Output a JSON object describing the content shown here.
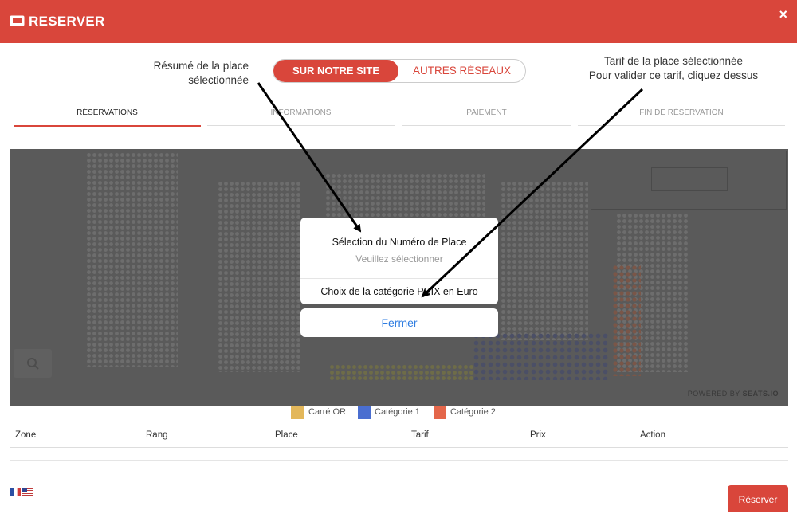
{
  "header": {
    "title": "RESERVER",
    "close_label": "×"
  },
  "annotations": {
    "left": {
      "line1": "Résumé de la place",
      "line2": "sélectionnée"
    },
    "right": {
      "line1": "Tarif de la place sélectionnée",
      "line2": "Pour valider ce tarif, cliquez dessus"
    }
  },
  "toggle": {
    "active": "SUR NOTRE SITE",
    "inactive": "AUTRES RÉSEAUX"
  },
  "steps": [
    "RÉSERVATIONS",
    "INFORMATIONS",
    "PAIEMENT",
    "FIN DE RÉSERVATION"
  ],
  "seatmap": {
    "powered_by": "POWERED BY",
    "brand": "SEATS.IO"
  },
  "popup": {
    "selection_title": "Sélection du Numéro de Place",
    "selection_placeholder": "Veuillez sélectionner",
    "category": "Choix de la catégorie PRIX en Euro",
    "close_label": "Fermer"
  },
  "legend": [
    {
      "label": "Carré OR",
      "color": "#e3b75a"
    },
    {
      "label": "Catégorie 1",
      "color": "#4a6ed0"
    },
    {
      "label": "Catégorie 2",
      "color": "#e4664a"
    }
  ],
  "table": {
    "headers": [
      "Zone",
      "Rang",
      "Place",
      "Tarif",
      "Prix",
      "Action"
    ]
  },
  "footer": {
    "reserve_label": "Réserver"
  },
  "colors": {
    "accent": "#d9463b",
    "link": "#2f7de1"
  }
}
